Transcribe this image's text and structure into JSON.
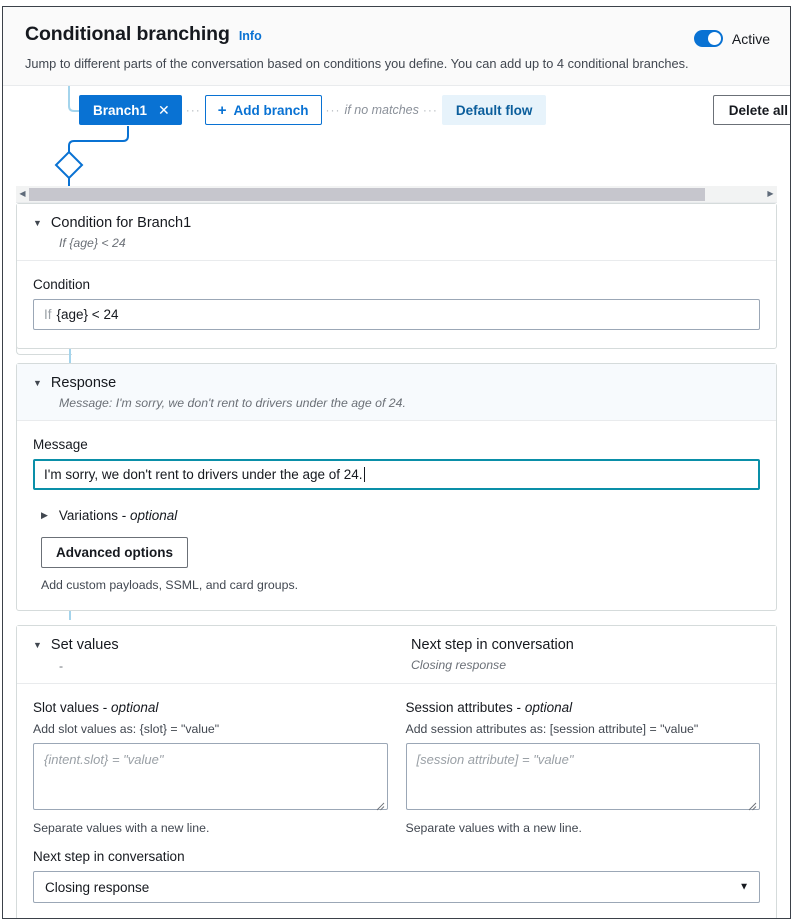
{
  "header": {
    "title": "Conditional branching",
    "info_label": "Info",
    "description": "Jump to different parts of the conversation based on conditions you define. You can add up to 4 conditional branches.",
    "toggle_label": "Active",
    "toggle_on": true,
    "accent_color": "#0972d3"
  },
  "branch_bar": {
    "branch_tab_label": "Branch1",
    "close_glyph": "✕",
    "add_branch_label": "Add branch",
    "plus_glyph": "+",
    "if_no_matches_label": "if no matches",
    "default_flow_label": "Default flow",
    "delete_all_label": "Delete all",
    "dots": "···"
  },
  "scrollbar": {
    "left_arrow": "◀",
    "right_arrow": "▶"
  },
  "condition_card": {
    "header_title": "Condition for Branch1",
    "header_summary": "If {age} < 24",
    "caret": "▼",
    "field_label": "Condition",
    "input_prefix": "If",
    "input_value": "{age} < 24"
  },
  "response_card": {
    "header_title": "Response",
    "header_summary": "Message: I'm sorry, we don't rent to drivers under the age of 24.",
    "caret": "▼",
    "message_label": "Message",
    "message_value": "I'm sorry, we don't rent to drivers under the age of 24.",
    "variations_label": "Variations - ",
    "variations_optional": "optional",
    "variations_caret": "▶",
    "advanced_options_label": "Advanced options",
    "advanced_hint": "Add custom payloads, SSML, and card groups."
  },
  "set_values_card": {
    "header_title": "Set values",
    "header_summary": "-",
    "caret": "▼",
    "next_step_title": "Next step in conversation",
    "next_step_summary": "Closing response",
    "slot_values_label": "Slot values - ",
    "slot_values_optional": "optional",
    "slot_values_hint": "Add slot values as: {slot} = \"value\"",
    "slot_values_placeholder": "{intent.slot} = \"value\"",
    "slot_values_value": "",
    "slot_values_foot": "Separate values with a new line.",
    "session_attrs_label": "Session attributes - ",
    "session_attrs_optional": "optional",
    "session_attrs_hint": "Add session attributes as: [session attribute] = \"value\"",
    "session_attrs_placeholder": "[session attribute] = \"value\"",
    "session_attrs_value": "",
    "session_attrs_foot": "Separate values with a new line.",
    "next_step_label": "Next step in conversation",
    "next_step_selected": "Closing response",
    "next_step_arrow": "▼"
  }
}
